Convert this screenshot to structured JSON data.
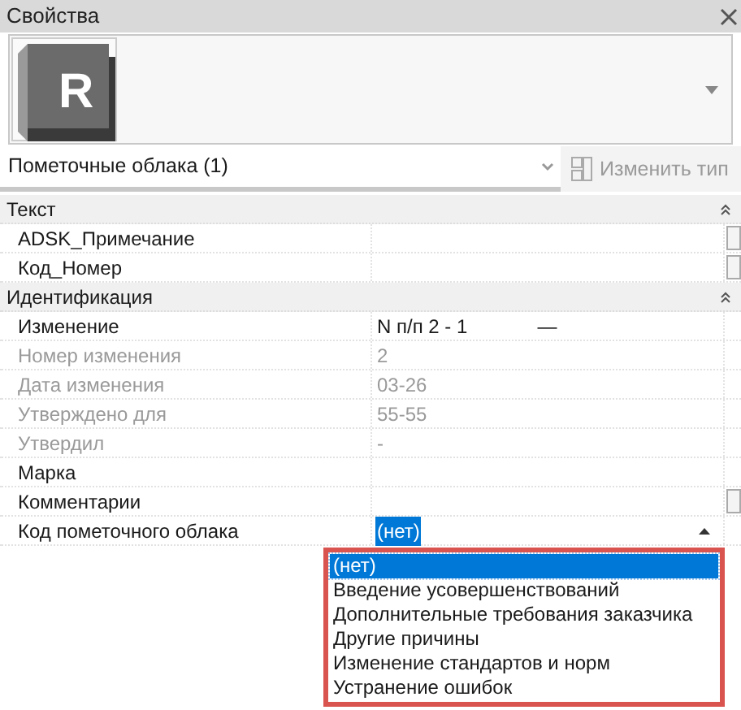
{
  "window": {
    "title": "Свойства"
  },
  "type_selector": {
    "logo_letter": "R"
  },
  "type_dropdown": {
    "value": "Пометочные облака (1)"
  },
  "edit_type_button": {
    "label": "Изменить тип",
    "disabled": true
  },
  "groups": [
    {
      "title": "Текст",
      "expanded": true,
      "rows": [
        {
          "label": "ADSK_Примечание",
          "value": "",
          "disabled": false,
          "has_button": true,
          "selected": false
        },
        {
          "label": "Код_Номер",
          "value": "",
          "disabled": false,
          "has_button": true,
          "selected": false
        }
      ]
    },
    {
      "title": "Идентификация",
      "expanded": true,
      "rows": [
        {
          "label": "Изменение",
          "value": "N п/п 2 - 1",
          "extra": "—",
          "disabled": false,
          "has_button": false,
          "selected": false
        },
        {
          "label": "Номер изменения",
          "value": "2",
          "disabled": true,
          "has_button": false,
          "selected": false
        },
        {
          "label": "Дата изменения",
          "value": "03-26",
          "disabled": true,
          "has_button": false,
          "selected": false
        },
        {
          "label": "Утверждено для",
          "value": "55-55",
          "disabled": true,
          "has_button": false,
          "selected": false
        },
        {
          "label": "Утвердил",
          "value": "-",
          "disabled": true,
          "has_button": false,
          "selected": false
        },
        {
          "label": "Марка",
          "value": "",
          "disabled": false,
          "has_button": false,
          "selected": false
        },
        {
          "label": "Комментарии",
          "value": "",
          "disabled": false,
          "has_button": true,
          "selected": false
        },
        {
          "label": "Код пометочного облака",
          "value": "(нет)",
          "disabled": false,
          "has_button": false,
          "selected": true
        }
      ]
    }
  ],
  "dropdown_list": {
    "options": [
      {
        "label": "(нет)",
        "selected": true
      },
      {
        "label": "Введение усовершенствований",
        "selected": false
      },
      {
        "label": "Дополнительные требования заказчика",
        "selected": false
      },
      {
        "label": "Другие причины",
        "selected": false
      },
      {
        "label": "Изменение стандартов и норм",
        "selected": false
      },
      {
        "label": "Устранение ошибок",
        "selected": false
      }
    ]
  }
}
